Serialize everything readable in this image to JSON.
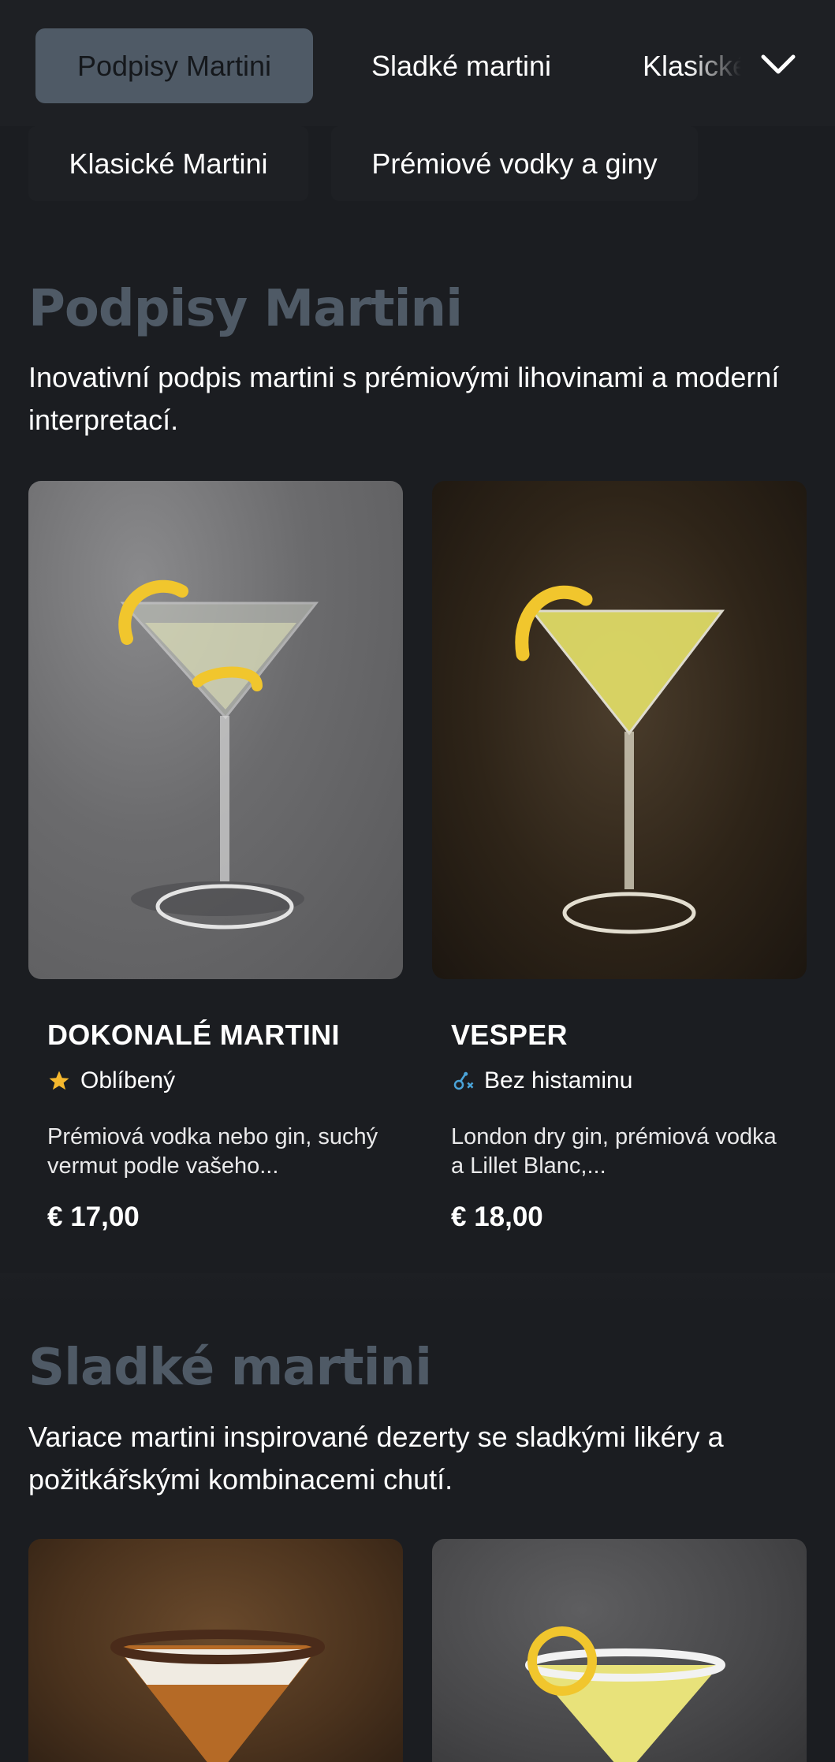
{
  "nav": {
    "tabs": [
      {
        "label": "Podpisy Martini",
        "active": true
      },
      {
        "label": "Sladké martini",
        "active": false
      },
      {
        "label": "Klasické Martini",
        "active": false
      },
      {
        "label": "Klasické Martini",
        "active": false
      },
      {
        "label": "Prémiové vodky a giny",
        "active": false
      }
    ],
    "expand_icon": "chevron-down-icon"
  },
  "sections": [
    {
      "title": "Podpisy Martini",
      "description": "Inovativní podpis martini s prémiovými lihovinami a moderní interpretací.",
      "items": [
        {
          "name": "DOKONALÉ MARTINI",
          "tag": "Oblíbený",
          "tag_icon": "star-icon",
          "description": "Prémiová vodka nebo gin, suchý vermut podle vašeho...",
          "price": "€ 17,00"
        },
        {
          "name": "VESPER",
          "tag": "Bez histaminu",
          "tag_icon": "molecule-icon",
          "description": "London dry gin, prémiová vodka a Lillet Blanc,...",
          "price": "€ 18,00"
        }
      ]
    },
    {
      "title": "Sladké martini",
      "description": "Variace martini inspirované dezerty se sladkými likéry a požitkářskými kombinacemi chutí."
    }
  ],
  "colors": {
    "background": "#1b1d21",
    "active_tab": "#4f5a66",
    "section_title": "#4f5a66",
    "star": "#f5b82e",
    "molecule": "#4aa3d8"
  }
}
